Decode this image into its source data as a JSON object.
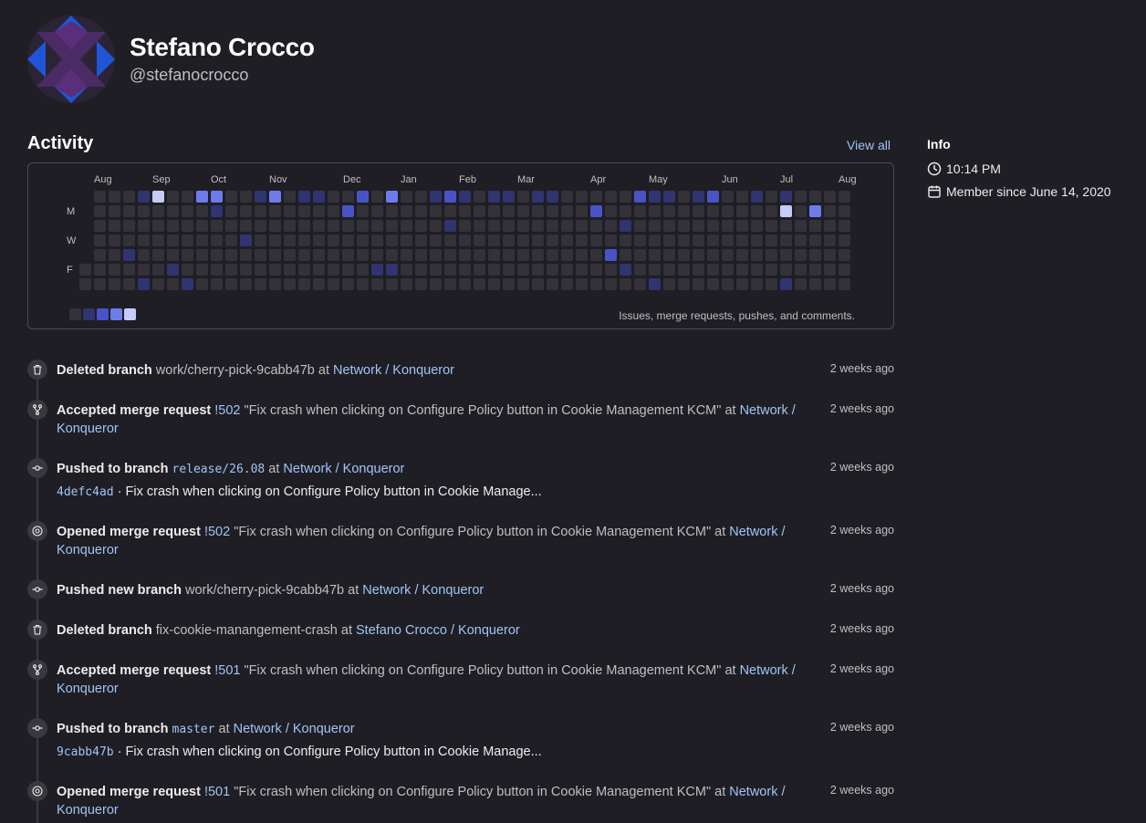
{
  "profile": {
    "name": "Stefano Crocco",
    "handle": "@stefanocrocco"
  },
  "activity": {
    "title": "Activity",
    "view_all": "View all",
    "months": [
      "Aug",
      "Sep",
      "Oct",
      "Nov",
      "Dec",
      "Jan",
      "Feb",
      "Mar",
      "Apr",
      "May",
      "Jun",
      "Jul",
      "Aug"
    ],
    "day_labels": [
      "M",
      "W",
      "F"
    ],
    "caption": "Issues, merge requests, pushes, and comments."
  },
  "info": {
    "title": "Info",
    "time": "10:14 PM",
    "member_since": "Member since June 14, 2020"
  },
  "colors": {
    "level0": "#333238",
    "level1": "#303470",
    "level2": "#4953c7",
    "level3": "#6e7bea",
    "level4": "#c6cbf9",
    "link": "#a0c4f7"
  },
  "events": [
    {
      "icon": "trash-icon",
      "action": "Deleted branch",
      "ref": "work/cherry-pick-9cabb47b",
      "at": "at",
      "project": "Network / Konqueror",
      "time": "2 weeks ago"
    },
    {
      "icon": "merge-icon",
      "action": "Accepted merge request",
      "mr": "!502",
      "title": "\"Fix crash when clicking on Configure Policy button in Cookie Management KCM\"",
      "at": "at",
      "project_a": "Network /",
      "project_b": "Konqueror",
      "time": "2 weeks ago"
    },
    {
      "icon": "commit-icon",
      "action": "Pushed to branch",
      "branch": "release/26.08",
      "at": "at",
      "project": "Network / Konqueror",
      "sha": "4defc4ad",
      "sep": "·",
      "message": "Fix crash when clicking on Configure Policy button in Cookie Manage...",
      "time": "2 weeks ago"
    },
    {
      "icon": "mr-open-icon",
      "action": "Opened merge request",
      "mr": "!502",
      "title": "\"Fix crash when clicking on Configure Policy button in Cookie Management KCM\"",
      "at": "at",
      "project_a": "Network /",
      "project_b": "Konqueror",
      "time": "2 weeks ago"
    },
    {
      "icon": "commit-icon",
      "action": "Pushed new branch",
      "ref": "work/cherry-pick-9cabb47b",
      "at": "at",
      "project": "Network / Konqueror",
      "time": "2 weeks ago"
    },
    {
      "icon": "trash-icon",
      "action": "Deleted branch",
      "ref": "fix-cookie-manangement-crash",
      "at": "at",
      "project": "Stefano Crocco / Konqueror",
      "time": "2 weeks ago"
    },
    {
      "icon": "merge-icon",
      "action": "Accepted merge request",
      "mr": "!501",
      "title": "\"Fix crash when clicking on Configure Policy button in Cookie Management KCM\"",
      "at": "at",
      "project_a": "Network /",
      "project_b": "Konqueror",
      "time": "2 weeks ago"
    },
    {
      "icon": "commit-icon",
      "action": "Pushed to branch",
      "branch": "master",
      "at": "at",
      "project": "Network / Konqueror",
      "sha": "9cabb47b",
      "sep": "·",
      "message": "Fix crash when clicking on Configure Policy button in Cookie Manage...",
      "time": "2 weeks ago"
    },
    {
      "icon": "mr-open-icon",
      "action": "Opened merge request",
      "mr": "!501",
      "title": "\"Fix crash when clicking on Configure Policy button in Cookie Management KCM\"",
      "at": "at",
      "project_a": "Network /",
      "project_b": "Konqueror",
      "time": "2 weeks ago"
    }
  ]
}
